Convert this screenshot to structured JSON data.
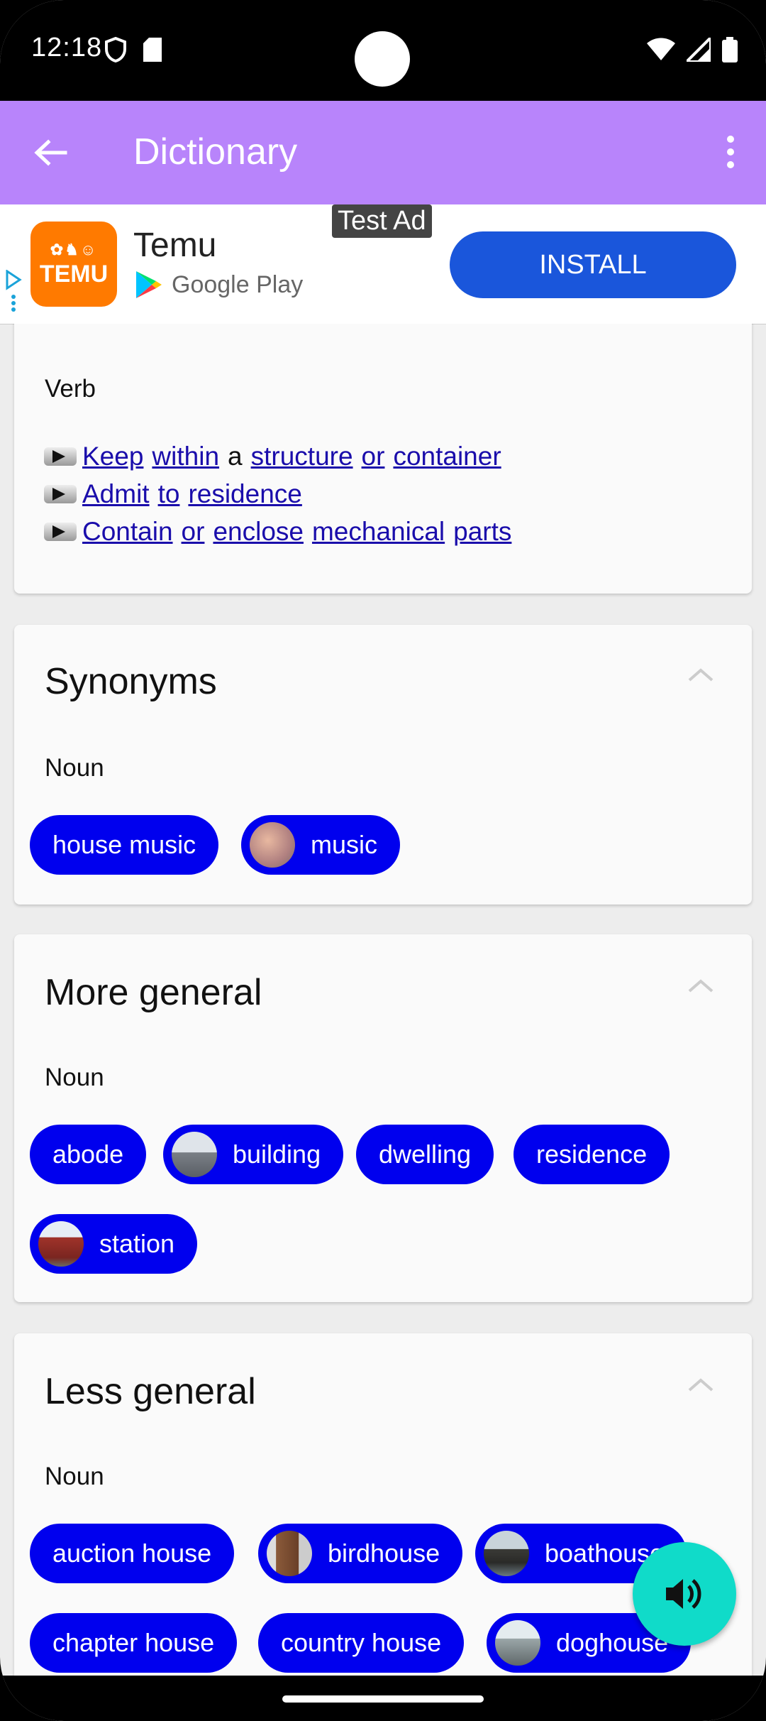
{
  "status": {
    "time": "12:18"
  },
  "appbar": {
    "title": "Dictionary"
  },
  "ad": {
    "label": "Test Ad",
    "app_name": "Temu",
    "store": "Google Play",
    "logo_text": "TEMU",
    "install_label": "INSTALL"
  },
  "verb_card": {
    "pos": "Verb",
    "definitions": [
      [
        "Keep",
        "within",
        "a",
        "structure",
        "or",
        "container"
      ],
      [
        "Admit",
        "to",
        "residence"
      ],
      [
        "Contain",
        "or",
        "enclose",
        "mechanical",
        "parts"
      ]
    ]
  },
  "synonyms": {
    "title": "Synonyms",
    "pos": "Noun",
    "chips": [
      "house music",
      "music"
    ]
  },
  "more_general": {
    "title": "More general",
    "pos": "Noun",
    "chips": [
      "abode",
      "building",
      "dwelling",
      "residence",
      "station"
    ]
  },
  "less_general": {
    "title": "Less general",
    "pos": "Noun",
    "chips": [
      "auction house",
      "birdhouse",
      "boathouse",
      "chapter house",
      "country house",
      "doghouse"
    ]
  },
  "colors": {
    "appbar": "#b884fb",
    "chip": "#0000ee",
    "fab": "#10dbc9",
    "install": "#1a56db"
  }
}
